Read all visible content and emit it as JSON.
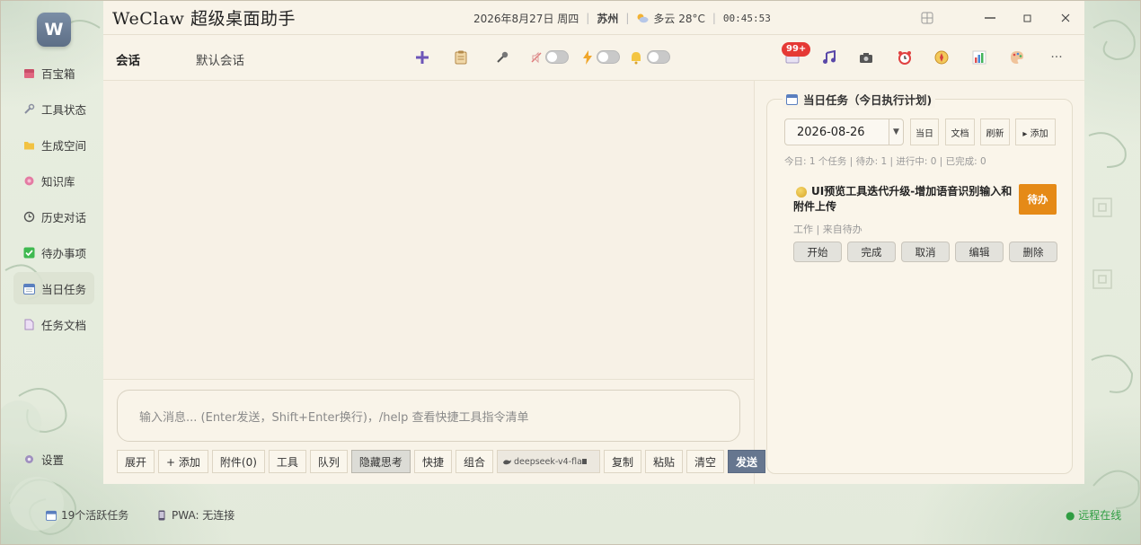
{
  "app": {
    "title": "WeClaw 超级桌面助手",
    "logo_letter": "W"
  },
  "title_info": {
    "date": "2026年8月27日 周四",
    "city": "苏州",
    "weather": "多云 28°C",
    "time": "00:45:53"
  },
  "window_controls": {
    "layout": "⊞",
    "minimize": "—",
    "maximize": "□",
    "close": "×"
  },
  "sidebar": {
    "items": [
      {
        "label": "百宝箱",
        "icon": "treasure-box-icon",
        "active": false
      },
      {
        "label": "工具状态",
        "icon": "tools-icon",
        "active": false
      },
      {
        "label": "生成空间",
        "icon": "folder-icon",
        "active": false
      },
      {
        "label": "知识库",
        "icon": "knowledge-icon",
        "active": false
      },
      {
        "label": "历史对话",
        "icon": "history-icon",
        "active": false
      },
      {
        "label": "待办事项",
        "icon": "checkbox-icon",
        "active": false
      },
      {
        "label": "当日任务",
        "icon": "calendar-icon",
        "active": true
      },
      {
        "label": "任务文档",
        "icon": "document-icon",
        "active": false
      }
    ],
    "settings_label": "设置"
  },
  "toolbar": {
    "session_label": "会话",
    "session_name": "默认会话",
    "badge": "99+"
  },
  "input": {
    "placeholder": "输入消息... (Enter发送，Shift+Enter换行)，/help 查看快捷工具指令清单"
  },
  "input_buttons": {
    "expand": "展开",
    "add": "+ 添加",
    "attach": "附件(0)",
    "tools": "工具",
    "queue": "队列",
    "hide_thinking": "隐藏思考",
    "shortcut": "快捷",
    "combo": "组合",
    "model": "deepseek-v4-fla",
    "copy": "复制",
    "paste": "粘贴",
    "clear": "清空",
    "send": "发送"
  },
  "task_panel": {
    "title": "当日任务（今日执行计划)",
    "date": "2026-08-26",
    "buttons": {
      "today": "当日",
      "doc": "文档",
      "refresh": "刷新",
      "add": "▸ 添加"
    },
    "stats": "今日: 1 个任务 | 待办: 1 | 进行中: 0 | 已完成: 0",
    "task": {
      "title": "UI预览工具迭代升级-增加语音识别输入和附件上传",
      "status": "待办",
      "meta": "工作 | 来自待办",
      "actions": {
        "start": "开始",
        "complete": "完成",
        "cancel": "取消",
        "edit": "编辑",
        "delete": "删除"
      }
    }
  },
  "statusbar": {
    "active_tasks": "19个活跃任务",
    "pwa": "PWA: 无连接",
    "remote": "● 远程在线"
  },
  "colors": {
    "accent": "#66768f",
    "status_pending": "#e58a17",
    "online": "#2f9d42",
    "badge": "#e53935"
  }
}
